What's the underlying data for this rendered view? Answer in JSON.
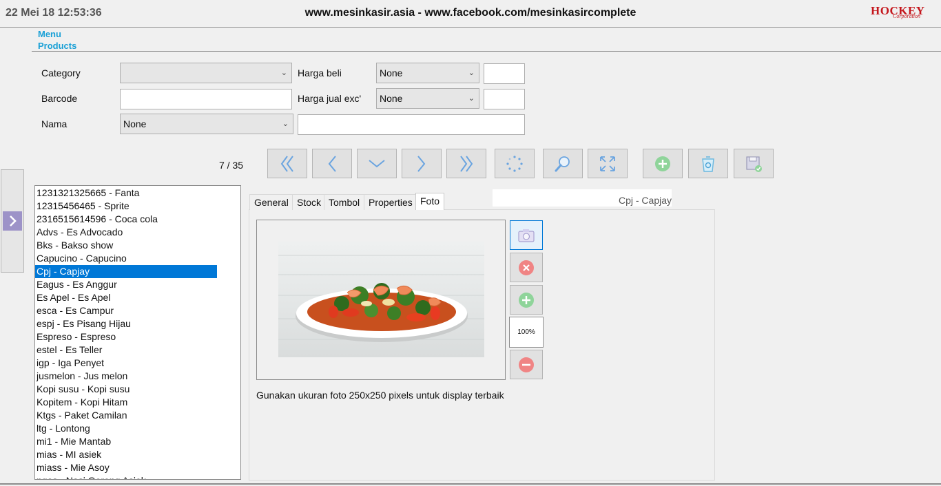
{
  "header": {
    "datetime": "22 Mei 18 12:53:36",
    "site": "www.mesinkasir.asia - www.facebook.com/mesinkasircomplete",
    "brand": "HOCKEY",
    "brand_sub": "Corporation"
  },
  "breadcrumb": {
    "menu": "Menu",
    "section": "Products"
  },
  "form": {
    "category_label": "Category",
    "category_value": "",
    "barcode_label": "Barcode",
    "barcode_value": "",
    "nama_label": "Nama",
    "nama_select_value": "None",
    "nama_value": "",
    "harga_beli_label": "Harga beli",
    "harga_beli_select": "None",
    "harga_beli_value": "",
    "harga_jual_label": "Harga jual exc'",
    "harga_jual_select": "None",
    "harga_jual_value": ""
  },
  "nav": {
    "record_count": "7 / 35"
  },
  "list": {
    "selected_index": 6,
    "items": [
      "1231321325665 - Fanta",
      "12315456465 - Sprite",
      "2316515614596 - Coca cola",
      "Advs - Es Advocado",
      "Bks - Bakso show",
      "Capucino - Capucino",
      "Cpj - Capjay",
      "Eagus - Es Anggur",
      "Es Apel - Es Apel",
      "esca - Es Campur",
      "espj - Es Pisang Hijau",
      "Espreso - Espreso",
      "estel - Es Teller",
      "igp - Iga Penyet",
      "jusmelon - Jus melon",
      "Kopi susu - Kopi susu",
      "Kopitem - Kopi Hitam",
      "Ktgs - Paket Camilan",
      "ltg - Lontong",
      "mi1 - Mie Mantab",
      "mias - MI asiek",
      "miass - Mie Asoy",
      "ngas - Nasi Goreng Asiek"
    ]
  },
  "tabs": [
    {
      "label": "General"
    },
    {
      "label": "Stock"
    },
    {
      "label": "Tombol"
    },
    {
      "label": "Properties"
    },
    {
      "label": "Foto"
    }
  ],
  "active_tab": "Foto",
  "tab_caption": "Cpj - Capjay",
  "photo": {
    "zoom": "100%",
    "hint": "Gunakan ukuran foto 250x250 pixels untuk display terbaik"
  },
  "colors": {
    "accent": "#1aa0d6",
    "selection": "#0078d7",
    "brand": "#c4161c",
    "add_green": "#8fd49a",
    "delete_red": "#f08484"
  }
}
